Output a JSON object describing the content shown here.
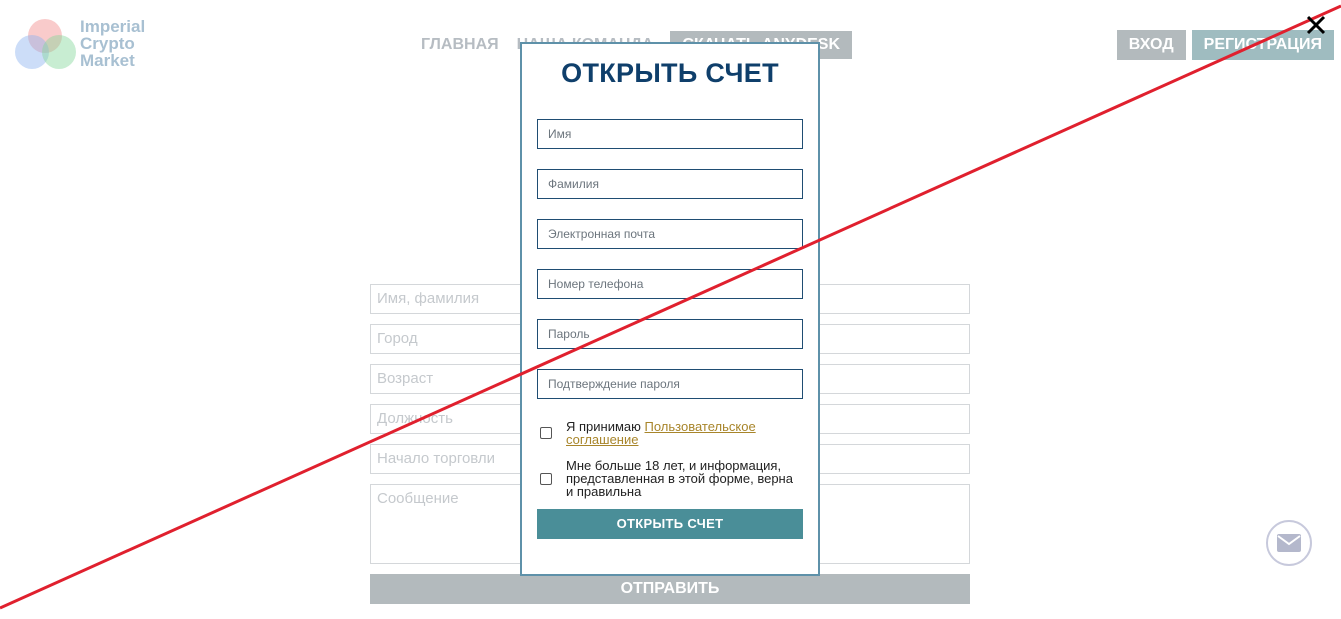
{
  "logo": {
    "lines": [
      "Imperial",
      "Crypto",
      "Market"
    ]
  },
  "nav": {
    "home": "ГЛАВНАЯ",
    "team": "НАША КОМАНДА",
    "download": "СКАЧАТЬ ANYDESK"
  },
  "auth": {
    "login": "ВХОД",
    "register": "РЕГИСТРАЦИЯ"
  },
  "contact_form": {
    "name_placeholder": "Имя, фамилия",
    "city_placeholder": "Город",
    "age_placeholder": "Возраст",
    "position_placeholder": "Должность",
    "trading_start_placeholder": "Начало торговли",
    "message_placeholder": "Сообщение",
    "submit_label": "ОТПРАВИТЬ"
  },
  "modal": {
    "title": "ОТКРЫТЬ СЧЕТ",
    "first_name_placeholder": "Имя",
    "last_name_placeholder": "Фамилия",
    "email_placeholder": "Электронная почта",
    "phone_placeholder": "Номер телефона",
    "password_placeholder": "Пароль",
    "password_confirm_placeholder": "Подтверждение пароля",
    "agreement_prefix": "Я принимаю",
    "agreement_link": "Пользовательское соглашение",
    "age_confirm": "Мне больше 18 лет, и информация, представленная в этой форме, верна и правильна",
    "submit_label": "ОТКРЫТЬ СЧЕТ"
  },
  "icons": {
    "close": "close-icon",
    "mail": "mail-icon"
  },
  "colors": {
    "modal_title": "#0f3f6b",
    "modal_border": "#5e91a9",
    "modal_button": "#4a8e98",
    "link": "#a8852a",
    "cross_line": "#e0202e"
  }
}
